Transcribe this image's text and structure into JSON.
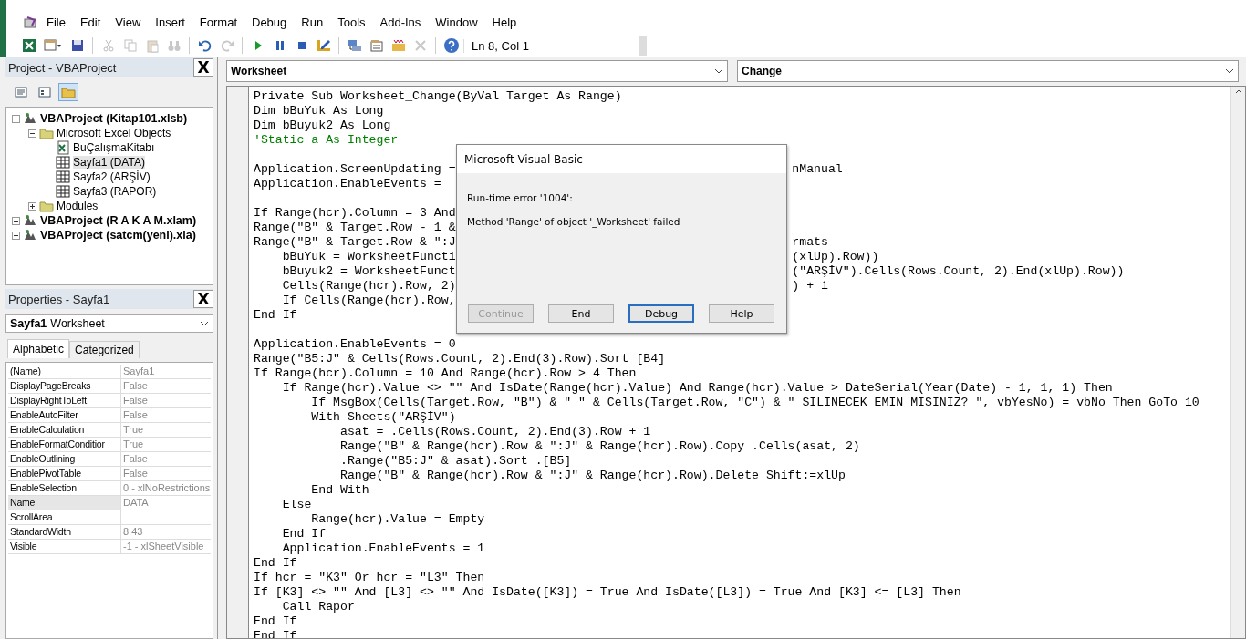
{
  "menu": [
    {
      "label": "File"
    },
    {
      "label": "Edit"
    },
    {
      "label": "View"
    },
    {
      "label": "Insert"
    },
    {
      "label": "Format"
    },
    {
      "label": "Debug"
    },
    {
      "label": "Run"
    },
    {
      "label": "Tools"
    },
    {
      "label": "Add-Ins"
    },
    {
      "label": "Window"
    },
    {
      "label": "Help"
    }
  ],
  "toolbar": {
    "tools": [
      {
        "kind": "excel",
        "disabled": false
      },
      {
        "kind": "insert-form",
        "disabled": false
      },
      {
        "kind": "save",
        "disabled": false
      },
      {
        "kind": "sep"
      },
      {
        "kind": "cut",
        "disabled": true
      },
      {
        "kind": "copy",
        "disabled": true
      },
      {
        "kind": "paste",
        "disabled": true
      },
      {
        "kind": "find",
        "disabled": true
      },
      {
        "kind": "sep"
      },
      {
        "kind": "undo",
        "disabled": false
      },
      {
        "kind": "redo",
        "disabled": true
      },
      {
        "kind": "sep"
      },
      {
        "kind": "run",
        "disabled": false
      },
      {
        "kind": "pause",
        "disabled": false
      },
      {
        "kind": "stop",
        "disabled": false
      },
      {
        "kind": "design",
        "disabled": false
      },
      {
        "kind": "sep"
      },
      {
        "kind": "project",
        "disabled": false
      },
      {
        "kind": "properties",
        "disabled": false
      },
      {
        "kind": "browser",
        "disabled": false
      },
      {
        "kind": "toolbox",
        "disabled": true
      },
      {
        "kind": "sep"
      },
      {
        "kind": "help",
        "disabled": false
      }
    ],
    "position": "Ln 8, Col 1"
  },
  "project_pane": {
    "title": "Project - VBAProject",
    "close": "X",
    "view_buttons": [
      {
        "kind": "view-code",
        "selected": false
      },
      {
        "kind": "view-object",
        "selected": false
      },
      {
        "kind": "toggle-folders",
        "selected": true
      }
    ],
    "tree": [
      {
        "kind": "project",
        "label": "VBAProject (Kitap101.xlsb)",
        "expanded": true,
        "selected": false,
        "children": [
          {
            "kind": "folder",
            "label": "Microsoft Excel Objects",
            "expanded": true,
            "selected": false,
            "children": [
              {
                "kind": "workbook",
                "label": "BuÇalışmaKitabı",
                "selected": false
              },
              {
                "kind": "sheet",
                "label": "Sayfa1 (DATA)",
                "selected": true
              },
              {
                "kind": "sheet",
                "label": "Sayfa2 (ARŞİV)",
                "selected": false
              },
              {
                "kind": "sheet",
                "label": "Sayfa3 (RAPOR)",
                "selected": false
              }
            ]
          },
          {
            "kind": "folder",
            "label": "Modules",
            "expanded": false,
            "selected": false
          }
        ]
      },
      {
        "kind": "project",
        "label": "VBAProject (R A K A M.xlam)",
        "expanded": false,
        "selected": false
      },
      {
        "kind": "project",
        "label": "VBAProject (satcm(yeni).xla)",
        "expanded": false,
        "selected": false
      }
    ]
  },
  "properties_pane": {
    "title": "Properties - Sayfa1",
    "close": "X",
    "object_name": "Sayfa1",
    "object_type": "Worksheet",
    "tabs": [
      {
        "label": "Alphabetic",
        "selected": true
      },
      {
        "label": "Categorized",
        "selected": false
      }
    ],
    "rows": [
      {
        "name": "(Name)",
        "value": "Sayfa1",
        "selected": false
      },
      {
        "name": "DisplayPageBreaks",
        "value": "False",
        "selected": false
      },
      {
        "name": "DisplayRightToLeft",
        "value": "False",
        "selected": false
      },
      {
        "name": "EnableAutoFilter",
        "value": "False",
        "selected": false
      },
      {
        "name": "EnableCalculation",
        "value": "True",
        "selected": false
      },
      {
        "name": "EnableFormatConditior",
        "value": "True",
        "selected": false
      },
      {
        "name": "EnableOutlining",
        "value": "False",
        "selected": false
      },
      {
        "name": "EnablePivotTable",
        "value": "False",
        "selected": false
      },
      {
        "name": "EnableSelection",
        "value": "0 - xlNoRestrictions",
        "selected": false
      },
      {
        "name": "Name",
        "value": "DATA",
        "selected": true
      },
      {
        "name": "ScrollArea",
        "value": "",
        "selected": false
      },
      {
        "name": "StandardWidth",
        "value": "8,43",
        "selected": false
      },
      {
        "name": "Visible",
        "value": "-1 - xlSheetVisible",
        "selected": false
      }
    ]
  },
  "code_window": {
    "object_box": "Worksheet",
    "procedure_box": "Change",
    "lines": [
      {
        "kind": "code",
        "text": "Private Sub Worksheet_Change(ByVal Target As Range)"
      },
      {
        "kind": "code",
        "text": "Dim bBuYuk As Long"
      },
      {
        "kind": "code",
        "text": "Dim bBuyuk2 As Long"
      },
      {
        "kind": "comment",
        "text": "'Static a As Integer"
      },
      {
        "kind": "blank"
      },
      {
        "kind": "code",
        "text": "Application.ScreenUpdating =",
        "tail": "nManual"
      },
      {
        "kind": "code",
        "text": "Application.EnableEvents ="
      },
      {
        "kind": "blank"
      },
      {
        "kind": "code",
        "text": "If Range(hcr).Column = 3 And"
      },
      {
        "kind": "code",
        "text": "Range(\"B\" & Target.Row - 1 &"
      },
      {
        "kind": "code",
        "text": "Range(\"B\" & Target.Row & \":J",
        "tail": "rmats"
      },
      {
        "kind": "code",
        "text": "    bBuYuk = WorksheetFuncti",
        "tail": "(xlUp).Row))"
      },
      {
        "kind": "code",
        "text": "    bBuyuk2 = WorksheetFunct",
        "tail": "(\"ARŞİV\").Cells(Rows.Count, 2).End(xlUp).Row))"
      },
      {
        "kind": "code",
        "text": "    Cells(Range(hcr).Row, 2)",
        "tail": ") + 1"
      },
      {
        "kind": "code",
        "text": "    If Cells(Range(hcr).Row,"
      },
      {
        "kind": "code",
        "text": "End If"
      },
      {
        "kind": "blank"
      },
      {
        "kind": "code",
        "text": "Application.EnableEvents = 0"
      },
      {
        "kind": "code",
        "text": "Range(\"B5:J\" & Cells(Rows.Count, 2).End(3).Row).Sort [B4]"
      },
      {
        "kind": "code",
        "text": "If Range(hcr).Column = 10 And Range(hcr).Row > 4 Then"
      },
      {
        "kind": "code",
        "text": "    If Range(hcr).Value <> \"\" And IsDate(Range(hcr).Value) And Range(hcr).Value > DateSerial(Year(Date) - 1, 1, 1) Then"
      },
      {
        "kind": "code",
        "text": "        If MsgBox(Cells(Target.Row, \"B\") & \" \" & Cells(Target.Row, \"C\") & \" SİLİNECEK EMİN MİSİNİZ? \", vbYesNo) = vbNo Then GoTo 10"
      },
      {
        "kind": "code",
        "text": "        With Sheets(\"ARŞİV\")"
      },
      {
        "kind": "code",
        "text": "            asat = .Cells(Rows.Count, 2).End(3).Row + 1"
      },
      {
        "kind": "code",
        "text": "            Range(\"B\" & Range(hcr).Row & \":J\" & Range(hcr).Row).Copy .Cells(asat, 2)"
      },
      {
        "kind": "code",
        "text": "            .Range(\"B5:J\" & asat).Sort .[B5]"
      },
      {
        "kind": "code",
        "text": "            Range(\"B\" & Range(hcr).Row & \":J\" & Range(hcr).Row).Delete Shift:=xlUp"
      },
      {
        "kind": "code",
        "text": "        End With"
      },
      {
        "kind": "code",
        "text": "    Else"
      },
      {
        "kind": "code",
        "text": "        Range(hcr).Value = Empty"
      },
      {
        "kind": "code",
        "text": "    End If"
      },
      {
        "kind": "code",
        "text": "    Application.EnableEvents = 1"
      },
      {
        "kind": "code",
        "text": "End If"
      },
      {
        "kind": "code",
        "text": "If hcr = \"K3\" Or hcr = \"L3\" Then"
      },
      {
        "kind": "code",
        "text": "If [K3] <> \"\" And [L3] <> \"\" And IsDate([K3]) = True And IsDate([L3]) = True And [K3] <= [L3] Then"
      },
      {
        "kind": "code",
        "text": "    Call Rapor"
      },
      {
        "kind": "code",
        "text": "End If"
      },
      {
        "kind": "code",
        "text": "End If"
      }
    ]
  },
  "dialog": {
    "title": "Microsoft Visual Basic",
    "message": "Run-time error '1004':",
    "detail": "Method 'Range' of object '_Worksheet' failed",
    "buttons": [
      {
        "label": "Continue",
        "disabled": true,
        "focused": false
      },
      {
        "label": "End",
        "disabled": false,
        "focused": false
      },
      {
        "label": "Debug",
        "disabled": false,
        "focused": true
      },
      {
        "label": "Help",
        "disabled": false,
        "focused": false
      }
    ]
  }
}
